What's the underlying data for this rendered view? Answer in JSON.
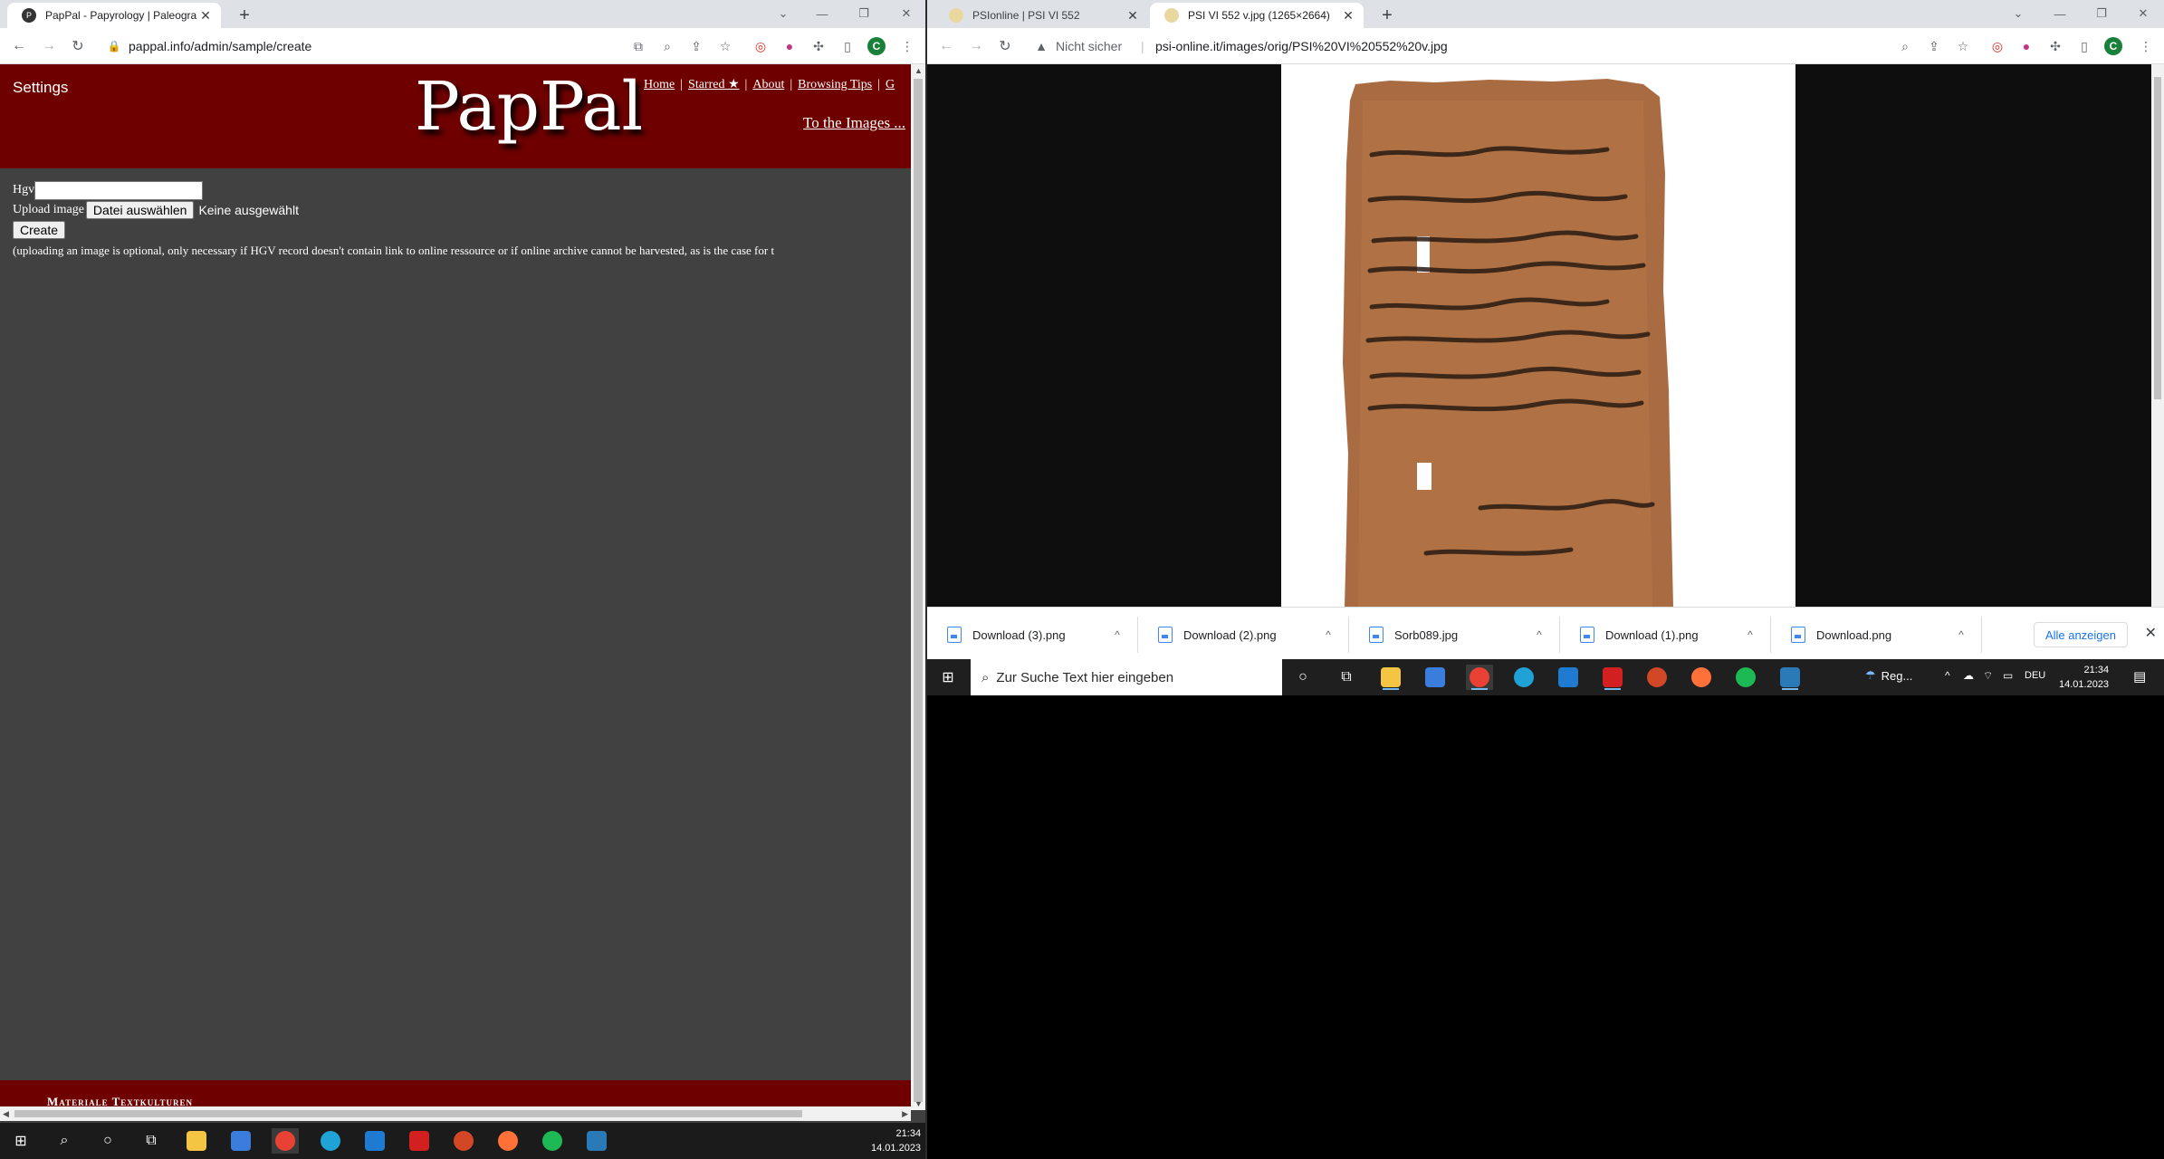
{
  "left_window": {
    "tabs": [
      {
        "title": "PapPal - Papyrology | Paleograph",
        "active": true
      }
    ],
    "url": "pappal.info/admin/sample/create",
    "page": {
      "settings_label": "Settings",
      "logo": "PapPal",
      "nav": [
        "Home",
        "Starred ★",
        "About",
        "Browsing Tips",
        "G"
      ],
      "to_images": "To the Images ...",
      "form": {
        "hgv_label": "Hgv",
        "hgv_value": "",
        "upload_label": "Upload image",
        "file_button": "Datei auswählen",
        "file_status": "Keine ausgewählt",
        "create_button": "Create",
        "note": "(uploading an image is optional, only necessary if HGV record doesn't contain link to online ressource or if online archive cannot be harvested, as is the case for t"
      },
      "footer_text": "Materiale Textkulturen"
    },
    "taskbar": {
      "time": "21:34",
      "date": "14.01.2023"
    }
  },
  "right_window": {
    "tabs": [
      {
        "title": "PSIonline | PSI VI 552",
        "active": false
      },
      {
        "title": "PSI VI 552 v.jpg (1265×2664)",
        "active": true
      }
    ],
    "security_label": "Nicht sicher",
    "url": "psi-online.it/images/orig/PSI%20VI%20552%20v.jpg",
    "downloads": [
      {
        "name": "Download (3).png"
      },
      {
        "name": "Download (2).png"
      },
      {
        "name": "Sorb089.jpg"
      },
      {
        "name": "Download (1).png"
      },
      {
        "name": "Download.png"
      }
    ],
    "show_all": "Alle anzeigen",
    "taskbar": {
      "search_placeholder": "Zur Suche Text hier eingeben",
      "weather": "Reg...",
      "lang": "DEU",
      "time": "21:34",
      "date": "14.01.2023"
    }
  },
  "colors": {
    "pappal_red": "#6e0000",
    "page_gray": "#414141",
    "chrome_blue": "#1a73e8"
  }
}
